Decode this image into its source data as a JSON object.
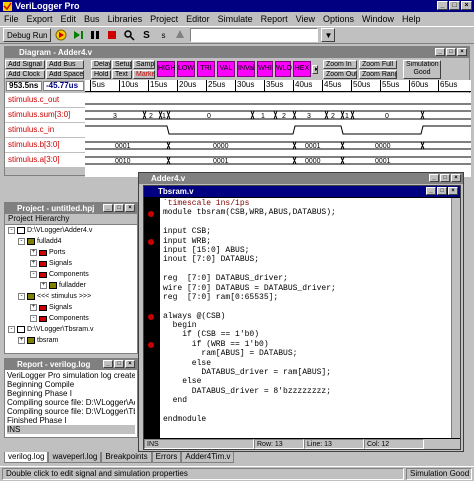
{
  "app": {
    "title": "VeriLogger Pro",
    "menu": [
      "File",
      "Export",
      "Edit",
      "Bus",
      "Libraries",
      "Project",
      "Editor",
      "Simulate",
      "Report",
      "View",
      "Options",
      "Window",
      "Help"
    ]
  },
  "toolbar": {
    "debug_run": "Debug Run",
    "s_label": "S"
  },
  "diagram": {
    "title": "Diagram - Adder4.v",
    "buttons": {
      "add_signal": "Add Signal",
      "add_bus": "Add Bus",
      "add_clock": "Add Clock",
      "add_spacer": "Add Spacer",
      "delay": "Delay",
      "setup": "Setup",
      "sample": "Sample",
      "hold": "Hold",
      "text": "Text",
      "marker": "Marker",
      "zoom_in": "Zoom In",
      "zoom_full": "Zoom Full",
      "zoom_out": "Zoom Out",
      "zoom_range": "Zoom Range",
      "sim_status": "Simulation Good"
    },
    "pattern_buttons": [
      "HIGH",
      "LOW",
      "TRI",
      "VAL",
      "INVal",
      "WHI",
      "WLO",
      "HEX"
    ],
    "cursor_time": "953.5ns",
    "delta_time": "-45.77us",
    "ruler_ticks": [
      "5us",
      "10us",
      "15us",
      "20us",
      "25us",
      "30us",
      "35us",
      "40us",
      "45us",
      "50us",
      "55us",
      "60us",
      "65us"
    ],
    "signals": [
      {
        "name": "stimulus.c_out"
      },
      {
        "name": "stimulus.sum[3:0]",
        "values": [
          "3",
          "2",
          "1",
          "0",
          "1",
          "2",
          "3",
          "2",
          "1",
          "1",
          "0"
        ]
      },
      {
        "name": "stimulus.c_in"
      },
      {
        "name": "stimulus.b[3:0]",
        "values": [
          "0001",
          "0000",
          "0001",
          "0000"
        ]
      },
      {
        "name": "stimulus.a[3:0]",
        "values": [
          "0010",
          "0001",
          "0000",
          "0001"
        ]
      }
    ]
  },
  "project": {
    "title": "Project - untitled.hpj",
    "header": "Project Hierarchy",
    "tree": [
      {
        "label": "D:\\VLogger\\Adder4.v",
        "indent": 0,
        "exp": "-"
      },
      {
        "label": "fulladd4",
        "indent": 1,
        "exp": "-"
      },
      {
        "label": "Ports",
        "indent": 2,
        "exp": "+"
      },
      {
        "label": "Signals",
        "indent": 2,
        "exp": "+"
      },
      {
        "label": "Components",
        "indent": 2,
        "exp": "-"
      },
      {
        "label": "fulladder",
        "indent": 3,
        "exp": "+"
      },
      {
        "label": "<<< stimulus >>>",
        "indent": 1,
        "exp": "-"
      },
      {
        "label": "Signals",
        "indent": 2,
        "exp": "+"
      },
      {
        "label": "Components",
        "indent": 2,
        "exp": "-"
      },
      {
        "label": "D:\\VLogger\\Tbsram.v",
        "indent": 0,
        "exp": "-"
      },
      {
        "label": "tbsram",
        "indent": 1,
        "exp": "+"
      }
    ]
  },
  "report": {
    "title": "Report - verilog.log",
    "lines": [
      "VeriLogger Pro simulation log created",
      "Beginning Compile",
      "Beginning Phase I",
      "Compiling source file: D:\\VLogger\\Adder4",
      "Compiling source file: D:\\VLogger\\Tbsram",
      "Finished Phase I",
      "INS"
    ]
  },
  "tabs": [
    "verilog.log",
    "waveperl.log",
    "Breakpoints",
    "Errors",
    "Adder4Tim.v"
  ],
  "status": {
    "message": "Double click to edit signal and simulation properties",
    "right": "Simulation Good"
  },
  "editor_outer": {
    "title": "Adder4.v"
  },
  "editor": {
    "title": "Tbsram.v",
    "lines": [
      "`timescale 1ns/1ps",
      "module tbsram(CSB,WRB,ABUS,DATABUS);",
      "",
      "input CSB;",
      "input WRB;",
      "input [15:0] ABUS;",
      "inout [7:0] DATABUS;",
      "",
      "reg  [7:0] DATABUS_driver;",
      "wire [7:0] DATABUS = DATABUS_driver;",
      "reg  [7:0] ram[0:65535];",
      "",
      "always @(CSB)",
      "  begin",
      "    if (CSB == 1'b0)",
      "      if (WRB == 1'b0)",
      "        ram[ABUS] = DATABUS;",
      "      else",
      "        DATABUS_driver = ram[ABUS];",
      "    else",
      "      DATABUS_driver = 8'bzzzzzzzz;",
      "  end",
      "",
      "endmodule",
      ""
    ],
    "status_ins": "INS",
    "status_row": "Row: 13",
    "status_line": "Line: 13",
    "status_col": "Col: 12"
  },
  "colors": {
    "title_active": "#000080",
    "title_inactive": "#808080",
    "pattern_button": "#ff00ff",
    "signal_name": "#cc0000",
    "breakpoint": "#cc0000",
    "keyword": "#0000cc"
  }
}
